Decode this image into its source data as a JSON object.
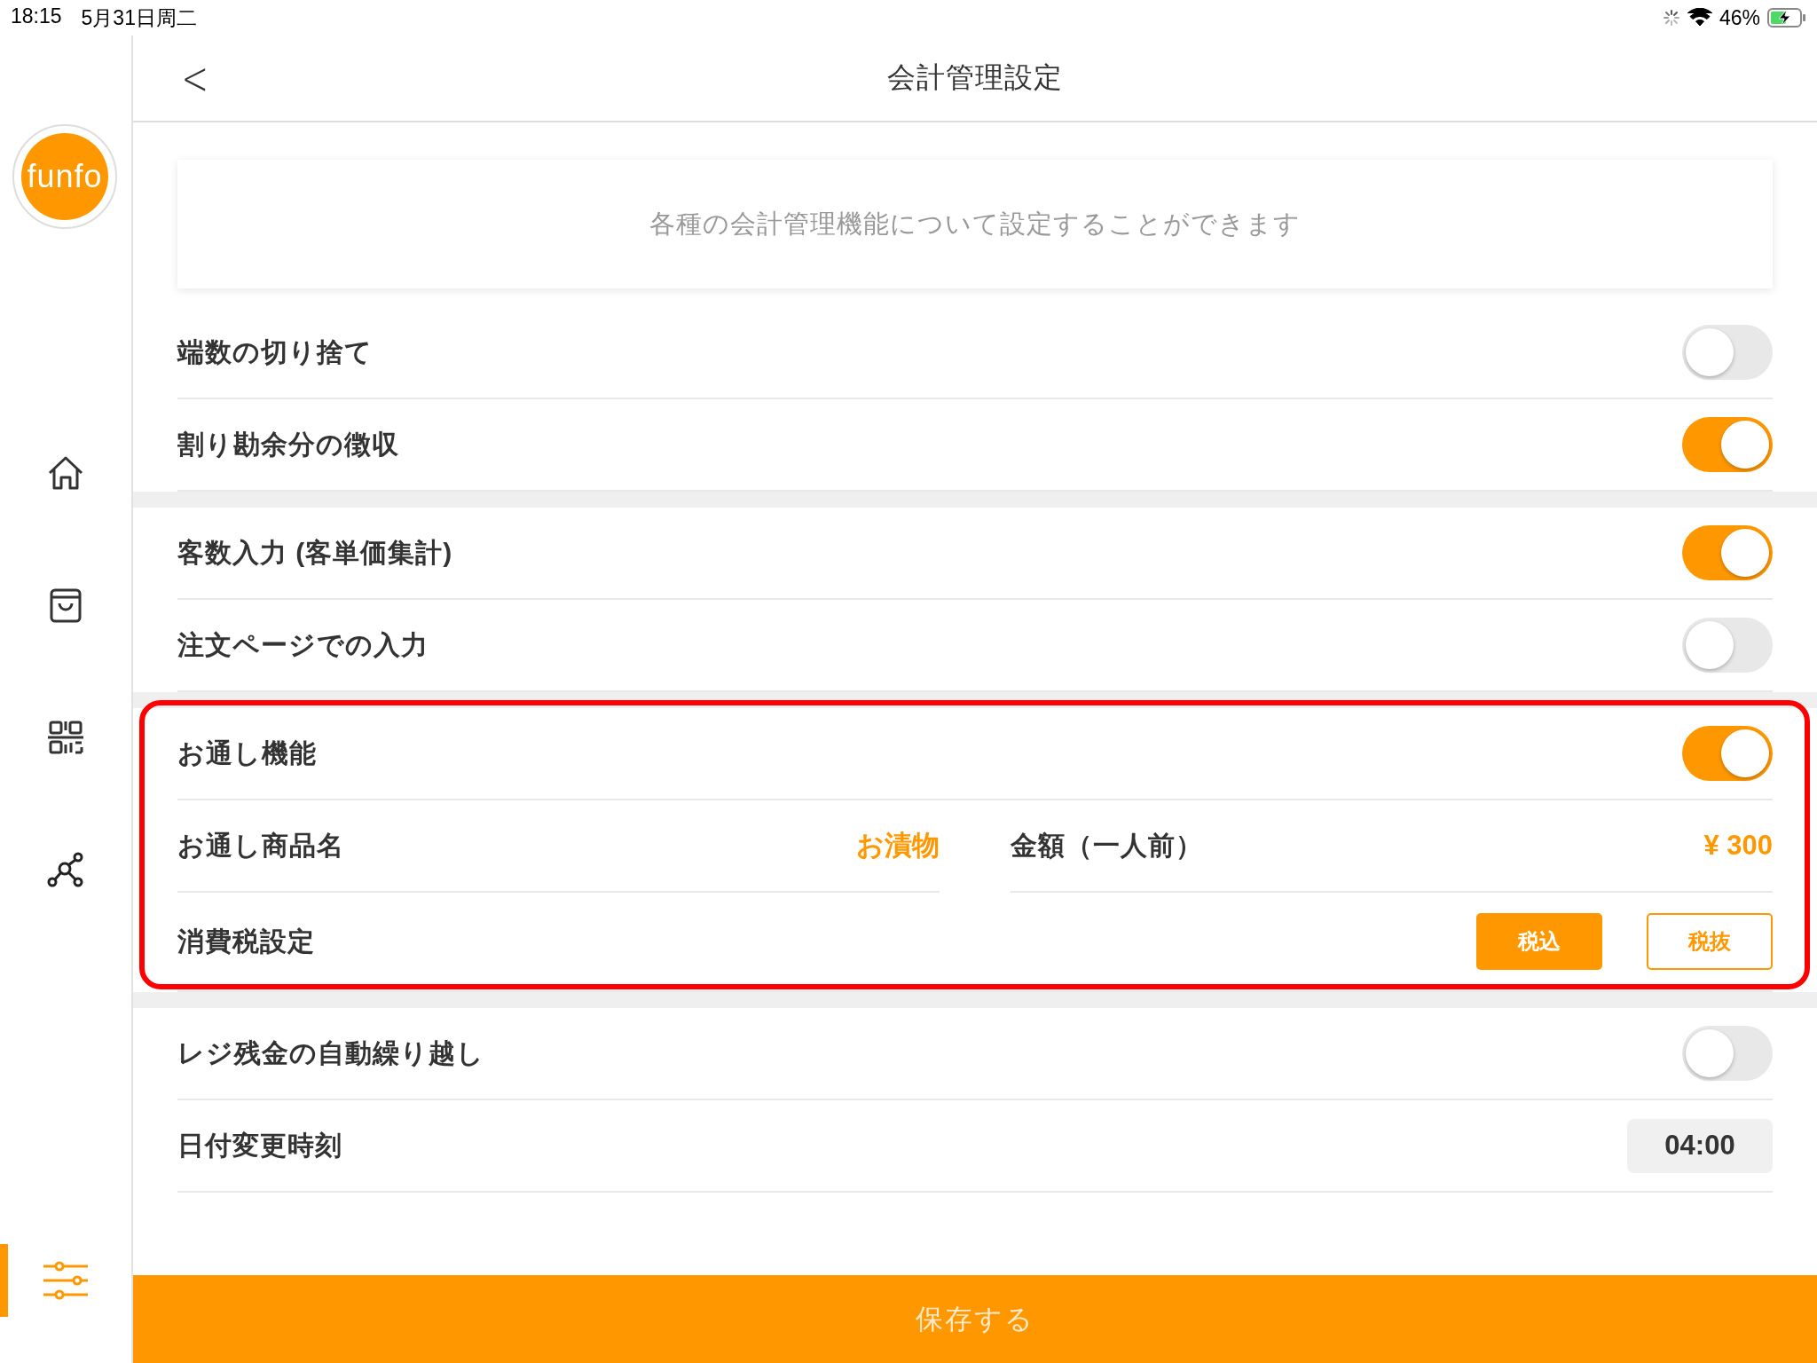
{
  "status_bar": {
    "time": "18:15",
    "date": "5月31日周二",
    "battery": "46%"
  },
  "sidebar": {
    "logo": "funfo",
    "items": [
      {
        "selected": false
      },
      {
        "selected": false
      },
      {
        "selected": false
      },
      {
        "selected": false
      },
      {
        "selected": true
      }
    ]
  },
  "header": {
    "back": "<",
    "title": "会計管理設定"
  },
  "description": "各種の会計管理機能について設定することができます",
  "sections": [
    {
      "highlighted": false,
      "rows": [
        {
          "kind": "toggle",
          "label": "端数の切り捨て",
          "on": false
        },
        {
          "kind": "toggle",
          "label": "割り勘余分の徴収",
          "on": true
        }
      ]
    },
    {
      "highlighted": false,
      "rows": [
        {
          "kind": "toggle",
          "label": "客数入力 (客単価集計)",
          "on": true
        },
        {
          "kind": "toggle",
          "label": "注文ページでの入力",
          "on": false
        }
      ]
    },
    {
      "highlighted": true,
      "rows": [
        {
          "kind": "toggle",
          "label": "お通し機能",
          "on": true
        },
        {
          "kind": "pair",
          "fields": [
            {
              "label": "お通し商品名",
              "value": "お漬物"
            },
            {
              "label": "金額（一人前）",
              "value": "¥ 300"
            }
          ]
        },
        {
          "kind": "choice",
          "label": "消費税設定",
          "options": [
            {
              "label": "税込",
              "selected": true
            },
            {
              "label": "税抜",
              "selected": false
            }
          ]
        }
      ]
    },
    {
      "highlighted": false,
      "rows": [
        {
          "kind": "toggle",
          "label": "レジ残金の自動繰り越し",
          "on": false
        },
        {
          "kind": "time",
          "label": "日付変更時刻",
          "value": "04:00"
        }
      ]
    }
  ],
  "save_button": "保存する"
}
